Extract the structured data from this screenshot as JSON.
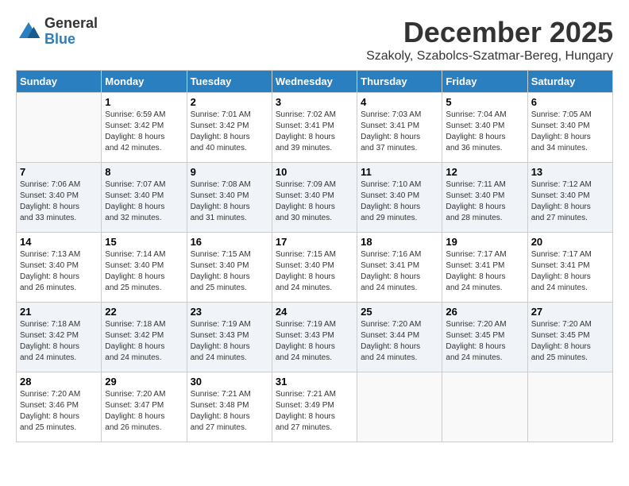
{
  "logo": {
    "general": "General",
    "blue": "Blue"
  },
  "title": "December 2025",
  "location": "Szakoly, Szabolcs-Szatmar-Bereg, Hungary",
  "days_header": [
    "Sunday",
    "Monday",
    "Tuesday",
    "Wednesday",
    "Thursday",
    "Friday",
    "Saturday"
  ],
  "weeks": [
    [
      {
        "day": "",
        "info": ""
      },
      {
        "day": "1",
        "info": "Sunrise: 6:59 AM\nSunset: 3:42 PM\nDaylight: 8 hours\nand 42 minutes."
      },
      {
        "day": "2",
        "info": "Sunrise: 7:01 AM\nSunset: 3:42 PM\nDaylight: 8 hours\nand 40 minutes."
      },
      {
        "day": "3",
        "info": "Sunrise: 7:02 AM\nSunset: 3:41 PM\nDaylight: 8 hours\nand 39 minutes."
      },
      {
        "day": "4",
        "info": "Sunrise: 7:03 AM\nSunset: 3:41 PM\nDaylight: 8 hours\nand 37 minutes."
      },
      {
        "day": "5",
        "info": "Sunrise: 7:04 AM\nSunset: 3:40 PM\nDaylight: 8 hours\nand 36 minutes."
      },
      {
        "day": "6",
        "info": "Sunrise: 7:05 AM\nSunset: 3:40 PM\nDaylight: 8 hours\nand 34 minutes."
      }
    ],
    [
      {
        "day": "7",
        "info": "Sunrise: 7:06 AM\nSunset: 3:40 PM\nDaylight: 8 hours\nand 33 minutes."
      },
      {
        "day": "8",
        "info": "Sunrise: 7:07 AM\nSunset: 3:40 PM\nDaylight: 8 hours\nand 32 minutes."
      },
      {
        "day": "9",
        "info": "Sunrise: 7:08 AM\nSunset: 3:40 PM\nDaylight: 8 hours\nand 31 minutes."
      },
      {
        "day": "10",
        "info": "Sunrise: 7:09 AM\nSunset: 3:40 PM\nDaylight: 8 hours\nand 30 minutes."
      },
      {
        "day": "11",
        "info": "Sunrise: 7:10 AM\nSunset: 3:40 PM\nDaylight: 8 hours\nand 29 minutes."
      },
      {
        "day": "12",
        "info": "Sunrise: 7:11 AM\nSunset: 3:40 PM\nDaylight: 8 hours\nand 28 minutes."
      },
      {
        "day": "13",
        "info": "Sunrise: 7:12 AM\nSunset: 3:40 PM\nDaylight: 8 hours\nand 27 minutes."
      }
    ],
    [
      {
        "day": "14",
        "info": "Sunrise: 7:13 AM\nSunset: 3:40 PM\nDaylight: 8 hours\nand 26 minutes."
      },
      {
        "day": "15",
        "info": "Sunrise: 7:14 AM\nSunset: 3:40 PM\nDaylight: 8 hours\nand 25 minutes."
      },
      {
        "day": "16",
        "info": "Sunrise: 7:15 AM\nSunset: 3:40 PM\nDaylight: 8 hours\nand 25 minutes."
      },
      {
        "day": "17",
        "info": "Sunrise: 7:15 AM\nSunset: 3:40 PM\nDaylight: 8 hours\nand 24 minutes."
      },
      {
        "day": "18",
        "info": "Sunrise: 7:16 AM\nSunset: 3:41 PM\nDaylight: 8 hours\nand 24 minutes."
      },
      {
        "day": "19",
        "info": "Sunrise: 7:17 AM\nSunset: 3:41 PM\nDaylight: 8 hours\nand 24 minutes."
      },
      {
        "day": "20",
        "info": "Sunrise: 7:17 AM\nSunset: 3:41 PM\nDaylight: 8 hours\nand 24 minutes."
      }
    ],
    [
      {
        "day": "21",
        "info": "Sunrise: 7:18 AM\nSunset: 3:42 PM\nDaylight: 8 hours\nand 24 minutes."
      },
      {
        "day": "22",
        "info": "Sunrise: 7:18 AM\nSunset: 3:42 PM\nDaylight: 8 hours\nand 24 minutes."
      },
      {
        "day": "23",
        "info": "Sunrise: 7:19 AM\nSunset: 3:43 PM\nDaylight: 8 hours\nand 24 minutes."
      },
      {
        "day": "24",
        "info": "Sunrise: 7:19 AM\nSunset: 3:43 PM\nDaylight: 8 hours\nand 24 minutes."
      },
      {
        "day": "25",
        "info": "Sunrise: 7:20 AM\nSunset: 3:44 PM\nDaylight: 8 hours\nand 24 minutes."
      },
      {
        "day": "26",
        "info": "Sunrise: 7:20 AM\nSunset: 3:45 PM\nDaylight: 8 hours\nand 24 minutes."
      },
      {
        "day": "27",
        "info": "Sunrise: 7:20 AM\nSunset: 3:45 PM\nDaylight: 8 hours\nand 25 minutes."
      }
    ],
    [
      {
        "day": "28",
        "info": "Sunrise: 7:20 AM\nSunset: 3:46 PM\nDaylight: 8 hours\nand 25 minutes."
      },
      {
        "day": "29",
        "info": "Sunrise: 7:20 AM\nSunset: 3:47 PM\nDaylight: 8 hours\nand 26 minutes."
      },
      {
        "day": "30",
        "info": "Sunrise: 7:21 AM\nSunset: 3:48 PM\nDaylight: 8 hours\nand 27 minutes."
      },
      {
        "day": "31",
        "info": "Sunrise: 7:21 AM\nSunset: 3:49 PM\nDaylight: 8 hours\nand 27 minutes."
      },
      {
        "day": "",
        "info": ""
      },
      {
        "day": "",
        "info": ""
      },
      {
        "day": "",
        "info": ""
      }
    ]
  ]
}
